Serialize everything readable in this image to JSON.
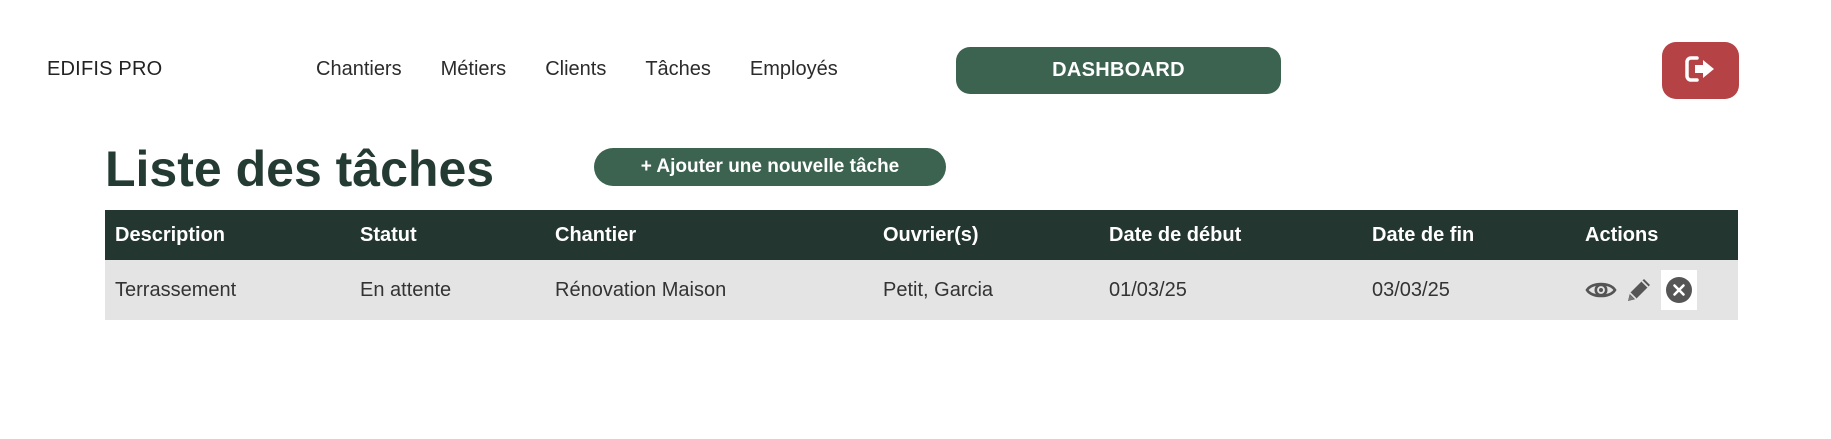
{
  "header": {
    "brand": "EDIFIS PRO",
    "nav": [
      "Chantiers",
      "Métiers",
      "Clients",
      "Tâches",
      "Employés"
    ],
    "dashboard_label": "DASHBOARD",
    "logout_icon": "sign-out-icon"
  },
  "page": {
    "title": "Liste des tâches",
    "add_label": "+ Ajouter une nouvelle tâche"
  },
  "table": {
    "headers": [
      "Description",
      "Statut",
      "Chantier",
      "Ouvrier(s)",
      "Date de début",
      "Date de fin",
      "Actions"
    ],
    "rows": [
      {
        "description": "Terrassement",
        "statut": "En attente",
        "chantier": "Rénovation Maison",
        "ouvriers": "Petit, Garcia",
        "date_debut": "01/03/25",
        "date_fin": "03/03/25",
        "actions": [
          "view-icon",
          "edit-icon",
          "delete-icon"
        ]
      }
    ]
  },
  "colors": {
    "primary": "#3b6350",
    "header_dark": "#233630",
    "logout": "#b54245",
    "row_bg": "#e4e4e4"
  }
}
